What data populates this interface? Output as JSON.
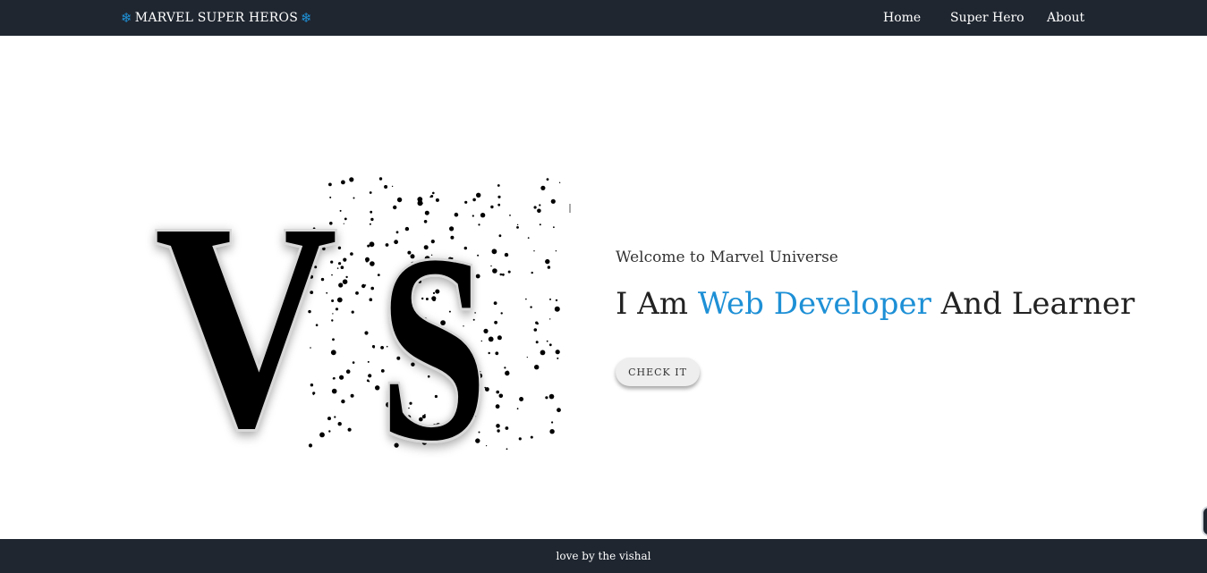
{
  "navbar": {
    "brand_label": "MARVEL SUPER HEROS",
    "brand_icon": "snowflake-icon",
    "links": [
      "Home",
      "Super Hero",
      "About"
    ]
  },
  "hero": {
    "logo_text": "VS",
    "subtitle": "Welcome to Marvel Universe",
    "headline_prefix": "I Am",
    "headline_accent": "Web Developer",
    "headline_suffix": "And Learner",
    "cta_label": "CHECK IT"
  },
  "footer": {
    "text": "love by the vishal"
  },
  "colors": {
    "nav_bg": "#1f2630",
    "accent": "#1e90d6",
    "page_bg": "#ffffff"
  }
}
